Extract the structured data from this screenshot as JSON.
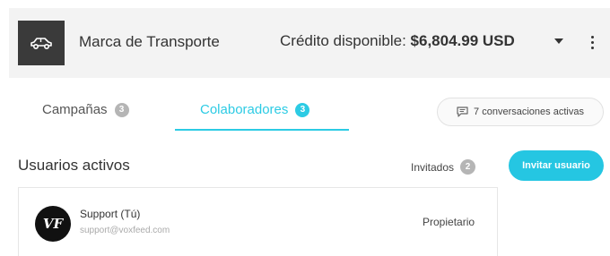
{
  "header": {
    "brand_icon": "car-icon",
    "brand_name": "Marca de Transporte",
    "credit_label": "Crédito disponible:",
    "credit_amount": "$6,804.99 USD",
    "menu_icon": "more-vertical-icon"
  },
  "tabs": [
    {
      "label": "Campañas",
      "count": "3",
      "active": false
    },
    {
      "label": "Colaboradores",
      "count": "3",
      "active": true
    }
  ],
  "conversations": {
    "icon": "chat-bubble-icon",
    "label": "7 conversaciones activas"
  },
  "users_section": {
    "title": "Usuarios activos",
    "invited_label": "Invitados",
    "invited_count": "2",
    "invite_button": "Invitar usuario"
  },
  "users": [
    {
      "avatar_text": "VF",
      "name": "Support (Tú)",
      "email": "support@voxfeed.com",
      "role": "Propietario"
    }
  ],
  "colors": {
    "accent": "#2ccbe4",
    "badge_gray": "#b5b5b5",
    "header_bg": "#f3f3f3"
  }
}
